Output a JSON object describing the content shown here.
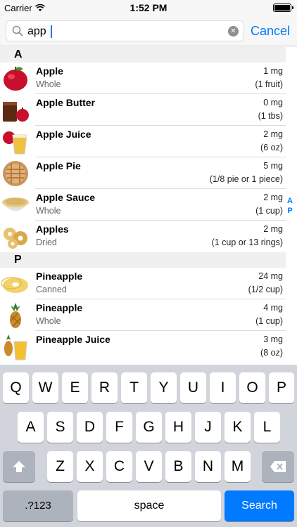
{
  "status_bar": {
    "carrier": "Carrier",
    "time": "1:52 PM"
  },
  "search": {
    "query": "app",
    "cancel_label": "Cancel"
  },
  "sections": [
    {
      "letter": "A",
      "rows": [
        {
          "name": "Apple",
          "subtitle": "Whole",
          "amount": "1 mg",
          "serving": "(1 fruit)",
          "icon": "apple-icon"
        },
        {
          "name": "Apple Butter",
          "subtitle": "",
          "amount": "0 mg",
          "serving": "(1 tbs)",
          "icon": "apple-butter-icon"
        },
        {
          "name": "Apple Juice",
          "subtitle": "",
          "amount": "2 mg",
          "serving": "(6 oz)",
          "icon": "apple-juice-icon"
        },
        {
          "name": "Apple Pie",
          "subtitle": "",
          "amount": "5 mg",
          "serving": "(1/8 pie or 1 piece)",
          "icon": "apple-pie-icon"
        },
        {
          "name": "Apple Sauce",
          "subtitle": "Whole",
          "amount": "2 mg",
          "serving": "(1 cup)",
          "icon": "apple-sauce-icon"
        },
        {
          "name": "Apples",
          "subtitle": "Dried",
          "amount": "2 mg",
          "serving": "(1 cup or 13 rings)",
          "icon": "dried-apples-icon"
        }
      ]
    },
    {
      "letter": "P",
      "rows": [
        {
          "name": "Pineapple",
          "subtitle": "Canned",
          "amount": "24 mg",
          "serving": "(1/2 cup)",
          "icon": "canned-pineapple-icon"
        },
        {
          "name": "Pineapple",
          "subtitle": "Whole",
          "amount": "4 mg",
          "serving": "(1 cup)",
          "icon": "pineapple-icon"
        },
        {
          "name": "Pineapple Juice",
          "subtitle": "",
          "amount": "3 mg",
          "serving": "(8 oz)",
          "icon": "pineapple-juice-icon"
        }
      ]
    }
  ],
  "section_index": [
    "A",
    "P"
  ],
  "keyboard": {
    "row1": [
      "Q",
      "W",
      "E",
      "R",
      "T",
      "Y",
      "U",
      "I",
      "O",
      "P"
    ],
    "row2": [
      "A",
      "S",
      "D",
      "F",
      "G",
      "H",
      "J",
      "K",
      "L"
    ],
    "row3": [
      "Z",
      "X",
      "C",
      "V",
      "B",
      "N",
      "M"
    ],
    "numbers_label": ".?123",
    "space_label": "space",
    "search_label": "Search"
  },
  "colors": {
    "accent": "#007aff",
    "keyboard_bg": "#d1d5db"
  }
}
